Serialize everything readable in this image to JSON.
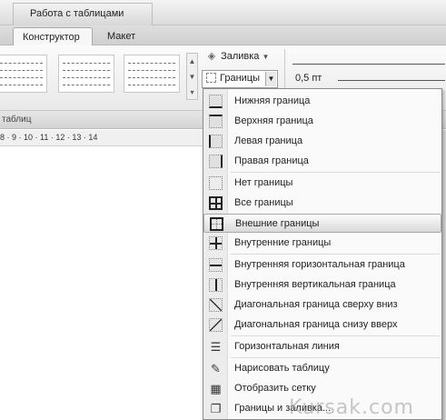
{
  "ribbon": {
    "context_title": "Работа с таблицами",
    "tabs": [
      {
        "label": "Конструктор",
        "active": true
      },
      {
        "label": "Макет",
        "active": false
      }
    ],
    "fill_label": "Заливка",
    "borders_label": "Границы",
    "line_weight": "0,5 пт",
    "group_label": "таблиц",
    "ruler_text": "8 · 9 · 10 · 11 · 12 · 13 · 14"
  },
  "menu": {
    "items": [
      {
        "label": "Нижняя граница",
        "icon": "bottom-border-icon"
      },
      {
        "label": "Верхняя граница",
        "icon": "top-border-icon"
      },
      {
        "label": "Левая граница",
        "icon": "left-border-icon"
      },
      {
        "label": "Правая граница",
        "icon": "right-border-icon"
      },
      {
        "label": "Нет границы",
        "icon": "no-border-icon"
      },
      {
        "label": "Все границы",
        "icon": "all-borders-icon"
      },
      {
        "label": "Внешние границы",
        "icon": "outside-borders-icon",
        "highlighted": true
      },
      {
        "label": "Внутренние границы",
        "icon": "inside-borders-icon"
      },
      {
        "label": "Внутренняя горизонтальная граница",
        "icon": "inside-horizontal-border-icon"
      },
      {
        "label": "Внутренняя вертикальная граница",
        "icon": "inside-vertical-border-icon"
      },
      {
        "label": "Диагональная граница сверху вниз",
        "icon": "diagonal-down-border-icon"
      },
      {
        "label": "Диагональная граница снизу вверх",
        "icon": "diagonal-up-border-icon"
      },
      {
        "label": "Горизонтальная линия",
        "icon": "horizontal-line-icon"
      },
      {
        "label": "Нарисовать таблицу",
        "icon": "draw-table-icon"
      },
      {
        "label": "Отобразить сетку",
        "icon": "view-gridlines-icon"
      },
      {
        "label": "Границы и заливка...",
        "icon": "borders-and-shading-icon"
      }
    ]
  },
  "watermark": "Kursak.com"
}
